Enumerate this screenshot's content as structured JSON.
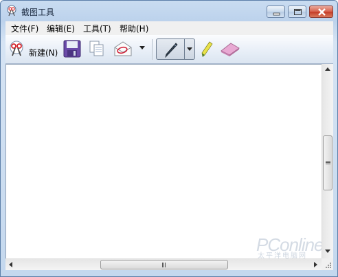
{
  "window": {
    "title": "截图工具"
  },
  "menu": {
    "items": [
      "文件(F)",
      "编辑(E)",
      "工具(T)",
      "帮助(H)"
    ]
  },
  "toolbar": {
    "new_label": "新建(N)"
  },
  "watermark": {
    "brand": "PConline",
    "sub": "太平洋电脑网"
  },
  "colors": {
    "accent": "#4a9bd9",
    "close_button": "#c43a26"
  },
  "icons": [
    "scissors-icon",
    "save-icon",
    "copy-icon",
    "send-icon",
    "dropdown-arrow-icon",
    "pen-icon",
    "highlighter-icon",
    "eraser-icon"
  ]
}
